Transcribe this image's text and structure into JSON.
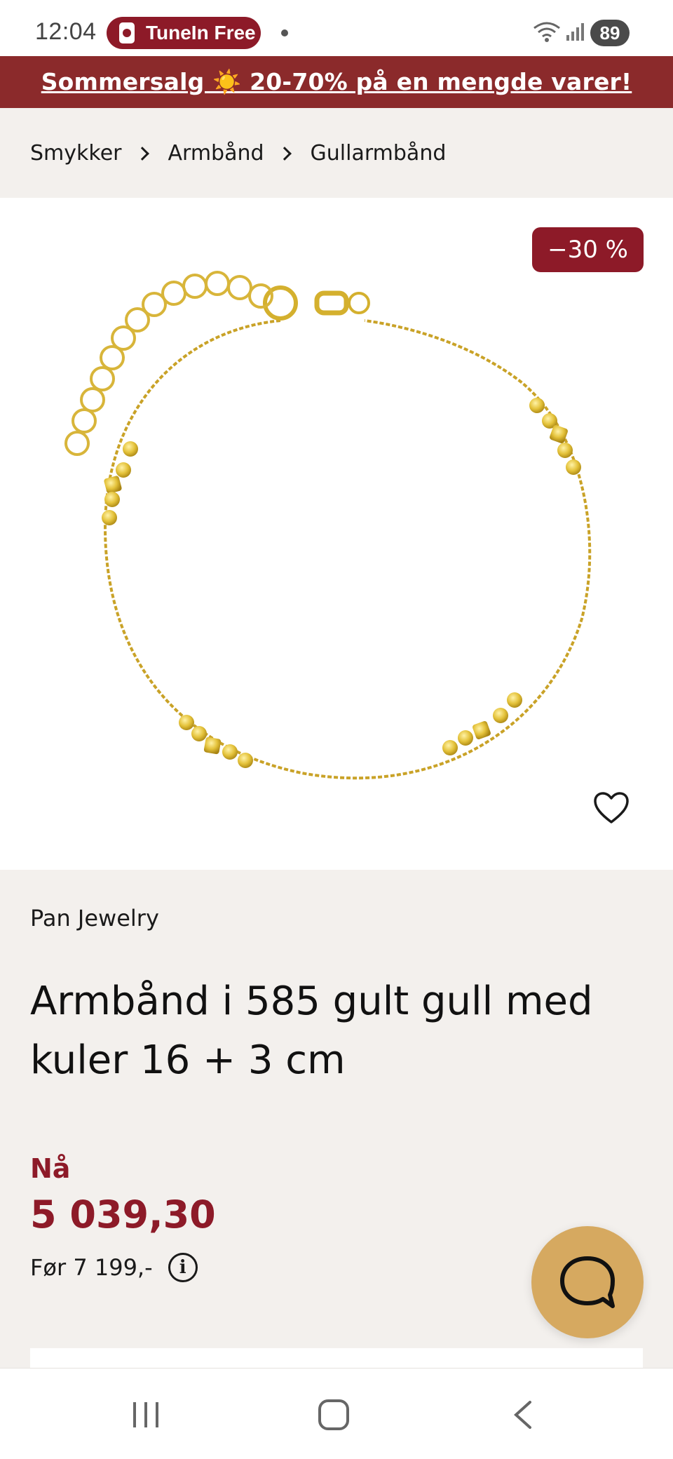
{
  "status_bar": {
    "time": "12:04",
    "notification_pill": "TuneIn Free",
    "battery": "89"
  },
  "sale_banner": {
    "text": "Sommersalg ☀️ 20-70% på en mengde varer!"
  },
  "breadcrumb": {
    "items": [
      "Smykker",
      "Armbånd",
      "Gullarmbånd"
    ]
  },
  "product": {
    "discount_badge": "−30 %",
    "brand": "Pan Jewelry",
    "title": "Armbånd i 585 gult gull med kuler 16 + 3 cm",
    "price_label": "Nå",
    "price_now": "5 039,30",
    "price_before": "Før 7 199,-",
    "image_icon": "gold-bracelet"
  },
  "colors": {
    "brand_red": "#8d1a28",
    "banner_red": "#8b2a2b",
    "chat_gold": "#d6a960",
    "background": "#f3f0ed"
  },
  "icons": {
    "favorite": "heart-outline-icon",
    "info": "info-circle-icon",
    "chat": "chat-bubble-icon",
    "nav_recent": "recent-apps-icon",
    "nav_home": "home-icon",
    "nav_back": "back-icon"
  }
}
